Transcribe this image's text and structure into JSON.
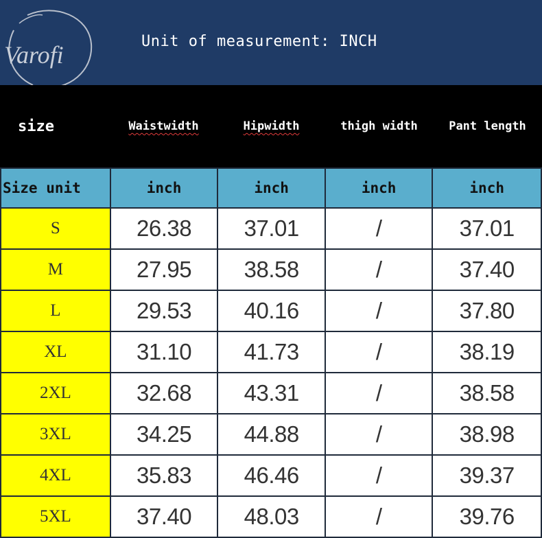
{
  "logo": {
    "text": "Varofi"
  },
  "banner": {
    "text": "Unit of measurement: INCH"
  },
  "header": {
    "size": "size",
    "columns": [
      "Waistwidth",
      "Hipwidth",
      "thigh width",
      "Pant length"
    ]
  },
  "unit_row": [
    "Size unit",
    "inch",
    "inch",
    "inch",
    "inch"
  ],
  "rows": [
    [
      "S",
      "26.38",
      "37.01",
      "/",
      "37.01"
    ],
    [
      "M",
      "27.95",
      "38.58",
      "/",
      "37.40"
    ],
    [
      "L",
      "29.53",
      "40.16",
      "/",
      "37.80"
    ],
    [
      "XL",
      "31.10",
      "41.73",
      "/",
      "38.19"
    ],
    [
      "2XL",
      "32.68",
      "43.31",
      "/",
      "38.58"
    ],
    [
      "3XL",
      "34.25",
      "44.88",
      "/",
      "38.98"
    ],
    [
      "4XL",
      "35.83",
      "46.46",
      "/",
      "39.37"
    ],
    [
      "5XL",
      "37.40",
      "48.03",
      "/",
      "39.76"
    ]
  ],
  "colors": {
    "banner": "#1f3b66",
    "header": "#000000",
    "unit_row": "#5aaecd",
    "size_column": "#ffff00"
  }
}
